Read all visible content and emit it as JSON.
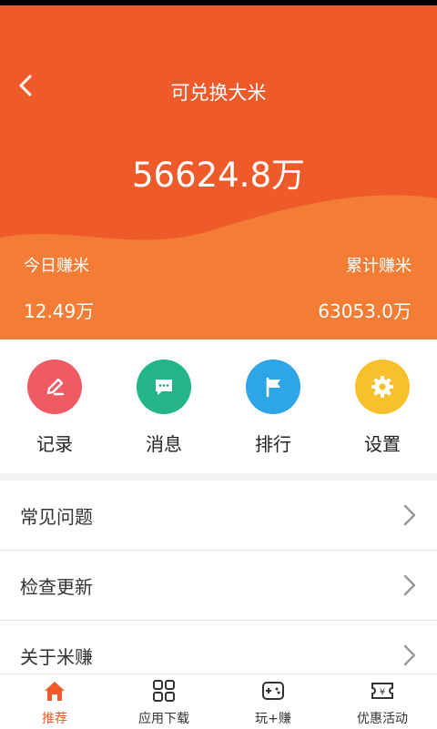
{
  "header": {
    "title": "可兑换大米",
    "amount": "56624.8万",
    "today_label": "今日赚米",
    "today_value": "12.49万",
    "total_label": "累计赚米",
    "total_value": "63053.0万"
  },
  "actions": [
    {
      "label": "记录",
      "icon": "pencil-icon",
      "color": "#f05b63"
    },
    {
      "label": "消息",
      "icon": "chat-bubble-icon",
      "color": "#23b48a"
    },
    {
      "label": "排行",
      "icon": "flag-icon",
      "color": "#2ea5e6"
    },
    {
      "label": "设置",
      "icon": "gear-icon",
      "color": "#f7c02c"
    }
  ],
  "menu": [
    {
      "label": "常见问题"
    },
    {
      "label": "检查更新"
    },
    {
      "label": "关于米赚"
    }
  ],
  "nav": [
    {
      "label": "推荐",
      "icon": "home-icon",
      "active": true
    },
    {
      "label": "应用下载",
      "icon": "grid-icon"
    },
    {
      "label": "玩+赚",
      "icon": "gamepad-icon"
    },
    {
      "label": "优惠活动",
      "icon": "ticket-icon"
    }
  ],
  "colors": {
    "primary": "#ef5a2a",
    "wave": "#f47d35"
  }
}
